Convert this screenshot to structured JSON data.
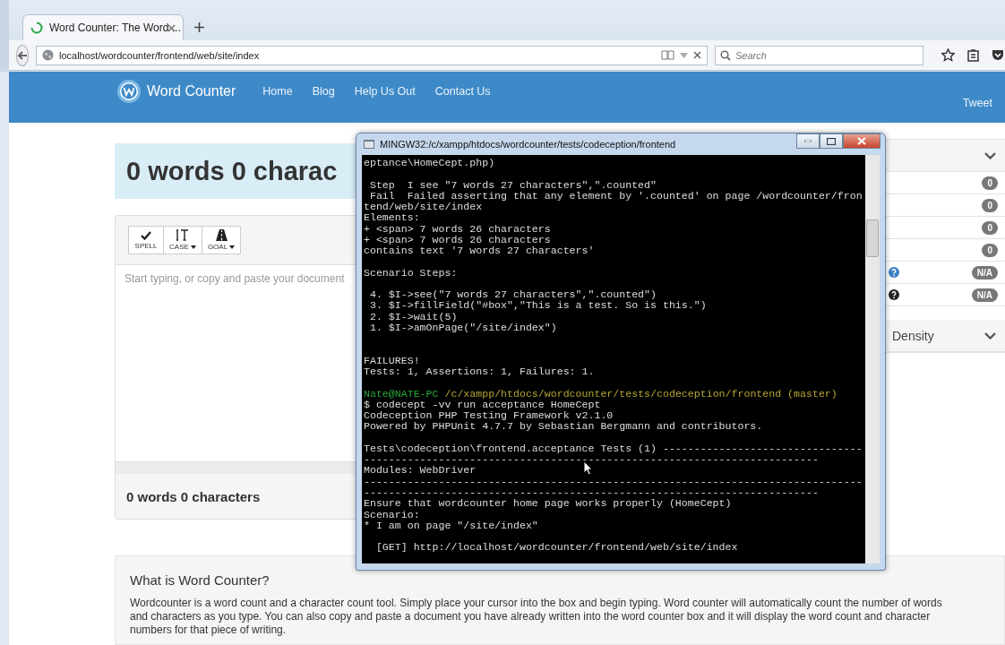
{
  "browser": {
    "tab": {
      "title": "Word Counter: The Word ...",
      "loading": true
    },
    "address": "localhost/wordcounter/frontend/web/site/index",
    "search": {
      "placeholder": "Search"
    }
  },
  "navbar": {
    "brand": "Word Counter",
    "links": [
      {
        "label": "Home"
      },
      {
        "label": "Blog"
      },
      {
        "label": "Help Us Out"
      },
      {
        "label": "Contact Us"
      }
    ],
    "tweet": "Tweet"
  },
  "count_header": "0 words 0 charac",
  "toolbar": [
    {
      "label": "SPELL",
      "kind": "check",
      "dropdown": false
    },
    {
      "label": "CASE",
      "kind": "case",
      "dropdown": true
    },
    {
      "label": "GOAL",
      "kind": "goal",
      "dropdown": true
    }
  ],
  "editor": {
    "placeholder": "Start typing, or copy and paste your document"
  },
  "count_footer": "0 words 0 characters",
  "stats_panel": {
    "rows": [
      {
        "value": "0"
      },
      {
        "value": "0"
      },
      {
        "value": "0"
      },
      {
        "value": "0"
      },
      {
        "value": "N/A",
        "color": "#3a7fc4"
      },
      {
        "value": "N/A",
        "color": "#222222"
      }
    ]
  },
  "density_panel": {
    "title": "Density"
  },
  "about": {
    "title": "What is Word Counter?",
    "text": "Wordcounter is a word count and a character count tool. Simply place your cursor into the box and begin typing. Word counter will automatically count the number of words and characters as you type. You can also copy and paste a document you have already written into the word counter box and it will display the word count and character numbers for that piece of writing."
  },
  "terminal": {
    "title": "MINGW32:/c/xampp/htdocs/wordcounter/tests/codeception/frontend",
    "lines": [
      {
        "text": "eptance\\HomeCept.php)"
      },
      {
        "kind": "blank"
      },
      {
        "text": " Step  I see \"7 words 27 characters\",\".counted\""
      },
      {
        "text": " Fail  Failed asserting that any element by '.counted' on page /wordcounter/fron"
      },
      {
        "text": "tend/web/site/index"
      },
      {
        "text": "Elements:"
      },
      {
        "text": "+ <span> 7 words 26 characters"
      },
      {
        "text": "+ <span> 7 words 26 characters"
      },
      {
        "text": "contains text '7 words 27 characters'"
      },
      {
        "kind": "blank"
      },
      {
        "text": "Scenario Steps:"
      },
      {
        "kind": "blank"
      },
      {
        "text": " 4. $I->see(\"7 words 27 characters\",\".counted\")"
      },
      {
        "text": " 3. $I->fillField(\"#box\",\"This is a test. So is this.\")"
      },
      {
        "text": " 2. $I->wait(5)"
      },
      {
        "text": " 1. $I->amOnPage(\"/site/index\")"
      },
      {
        "kind": "blank"
      },
      {
        "kind": "blank"
      },
      {
        "text": "FAILURES!"
      },
      {
        "text": "Tests: 1, Assertions: 1, Failures: 1."
      },
      {
        "kind": "blank"
      },
      {
        "kind": "prompt",
        "user": "Nate@NATE-PC",
        "path": "/c/xampp/htdocs/wordcounter/tests/codeception/frontend (master)"
      },
      {
        "text": "$ codecept -vv run acceptance HomeCept"
      },
      {
        "text": "Codeception PHP Testing Framework v2.1.0"
      },
      {
        "text": "Powered by PHPUnit 4.7.7 by Sebastian Bergmann and contributors."
      },
      {
        "kind": "blank"
      },
      {
        "text": "Tests\\codeception\\frontend.acceptance Tests (1) --------------------------------"
      },
      {
        "text": "-------------------------------------------------------------------------"
      },
      {
        "text": "Modules: WebDriver"
      },
      {
        "text": "--------------------------------------------------------------------------------"
      },
      {
        "text": "-------------------------------------------------------------------------"
      },
      {
        "text": "Ensure that wordcounter home page works properly (HomeCept)"
      },
      {
        "text": "Scenario:"
      },
      {
        "text": "* I am on page \"/site/index\""
      },
      {
        "kind": "blank"
      },
      {
        "text": "  [GET] http://localhost/wordcounter/frontend/web/site/index"
      }
    ]
  }
}
